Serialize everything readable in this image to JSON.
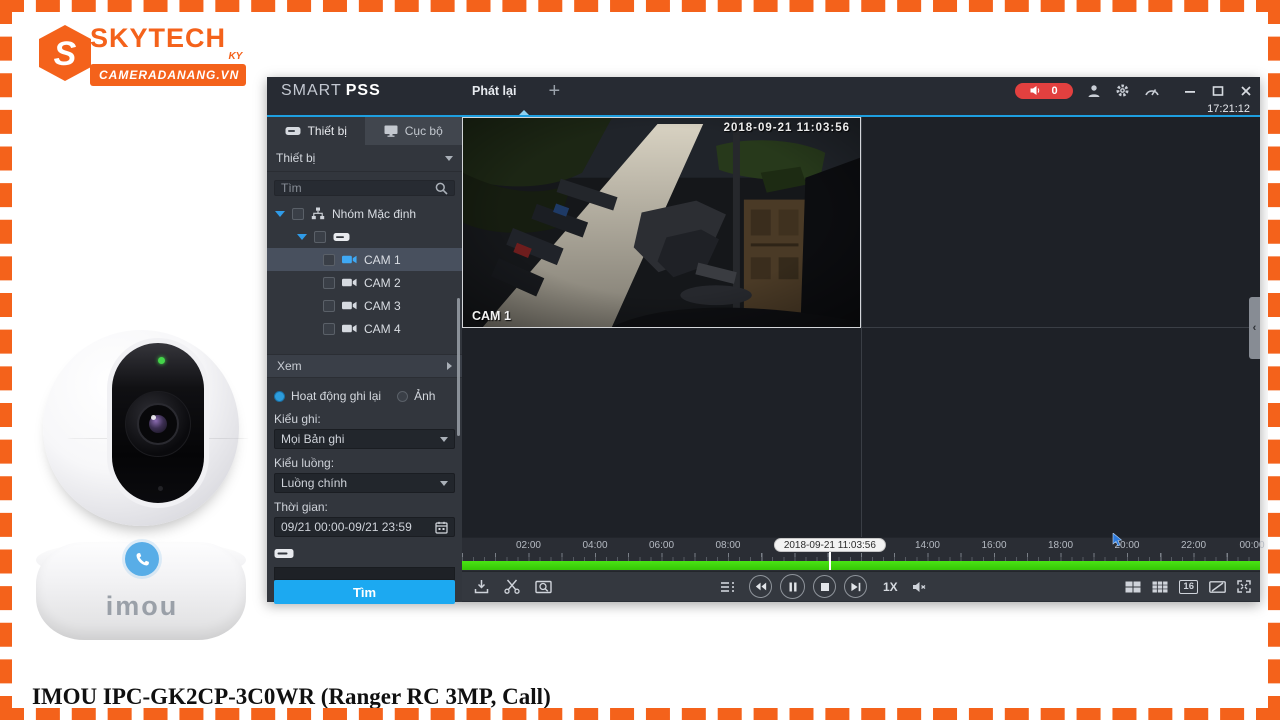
{
  "page": {
    "caption": "IMOU IPC-GK2CP-3C0WR (Ranger RC 3MP, Call)",
    "border_color": "#F4621B",
    "background": "#FFFFFF"
  },
  "logo": {
    "brand": "SKYTECH",
    "suffix": "KY",
    "banner": "CAMERADANANG.VN",
    "color": "#F4621B"
  },
  "product": {
    "brand": "imou",
    "led_color": "#44D44A",
    "call_button_color": "#58ADE7"
  },
  "app": {
    "titlebar": {
      "logo_primary": "SMART",
      "logo_secondary": "PSS",
      "tab": "Phát lại",
      "new_tab": "+",
      "alarm_count": "0",
      "clock": "17:21:12",
      "accent_color": "#1E9FE0"
    },
    "sidebar": {
      "tab_device": "Thiết bị",
      "tab_local": "Cục bộ",
      "device_select": "Thiết bị",
      "search_placeholder": "Tìm",
      "tree": {
        "group": "Nhóm Mặc định",
        "cameras": [
          "CAM 1",
          "CAM 2",
          "CAM 3",
          "CAM 4"
        ],
        "selected_index": 0
      },
      "view_section": "Xem",
      "radio_activity": "Hoạt động ghi lại",
      "radio_picture": "Ảnh",
      "record_type_label": "Kiểu ghi:",
      "record_type_value": "Mọi Bản ghi",
      "stream_type_label": "Kiểu luồng:",
      "stream_type_value": "Luồng chính",
      "time_label": "Thời gian:",
      "time_value": "09/21 00:00-09/21 23:59",
      "search_button": "Tìm",
      "button_color": "#1CA9F1"
    },
    "video": {
      "osd_timestamp": "2018-09-21 11:03:56",
      "camera_label": "CAM 1"
    },
    "timeline": {
      "tooltip": "2018-09-21 11:03:56",
      "playhead_pct": 46.1,
      "track_color_top": "#49E414",
      "labels": [
        {
          "text": "02:00",
          "pct": 8.33
        },
        {
          "text": "04:00",
          "pct": 16.67
        },
        {
          "text": "06:00",
          "pct": 25
        },
        {
          "text": "08:00",
          "pct": 33.33
        },
        {
          "text": "14:00",
          "pct": 58.33
        },
        {
          "text": "16:00",
          "pct": 66.67
        },
        {
          "text": "18:00",
          "pct": 75
        },
        {
          "text": "20:00",
          "pct": 83.33
        },
        {
          "text": "22:00",
          "pct": 91.67
        },
        {
          "text": "00:00",
          "pct": 99.0
        }
      ]
    },
    "toolbar": {
      "speed": "1X",
      "grid_16_label": "16"
    },
    "icons": [
      "alarm-speaker-icon",
      "user-icon",
      "gear-icon",
      "gauge-icon",
      "minimize-icon",
      "maximize-icon",
      "close-icon",
      "hdd-icon",
      "monitor-icon",
      "chevron-down-icon",
      "search-icon",
      "tree-expand-icon",
      "group-icon",
      "camera-icon",
      "section-arrow-icon",
      "radio-icon",
      "calendar-icon",
      "download-icon",
      "snip-icon",
      "smart-search-icon",
      "playlist-icon",
      "rewind-icon",
      "pause-icon",
      "stop-icon",
      "next-frame-icon",
      "mute-icon",
      "grid-4-icon",
      "grid-9-icon",
      "grid-16-icon",
      "split-icon",
      "fullscreen-icon",
      "collapse-icon",
      "phone-icon",
      "cursor-icon"
    ]
  }
}
